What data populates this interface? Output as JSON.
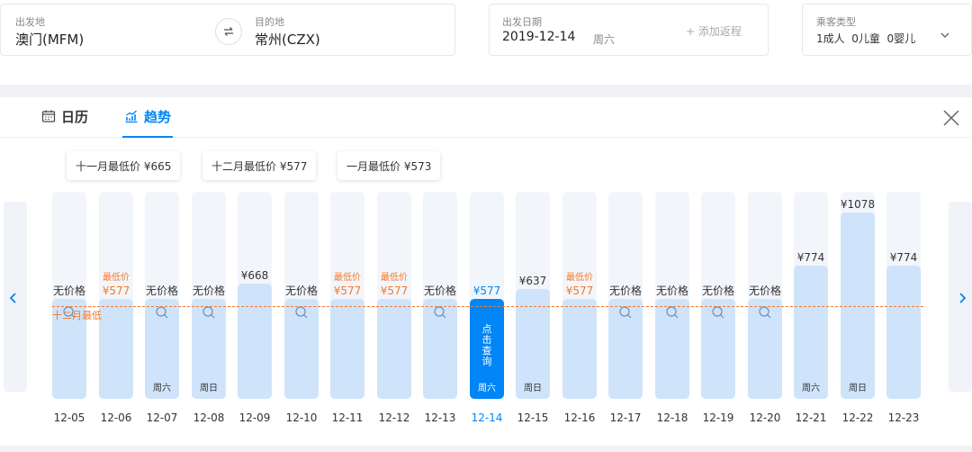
{
  "search": {
    "from_label": "出发地",
    "from_value": "澳门(MFM)",
    "to_label": "目的地",
    "to_value": "常州(CZX)",
    "date_label": "出发日期",
    "date_value": "2019-12-14",
    "weekday_value": "周六",
    "add_return": "+ 添加返程",
    "pax_label": "乘客类型",
    "pax_value": "1成人  0儿童  0婴儿"
  },
  "tabs": {
    "calendar": "日历",
    "trend": "趋势",
    "active": "trend"
  },
  "monthly_low": [
    {
      "label": "十一月最低价 ¥665"
    },
    {
      "label": "十二月最低价 ¥577"
    },
    {
      "label": "一月最低价 ¥573"
    }
  ],
  "lowest_line_label": "十二月最低",
  "click_label": "点击查询",
  "colors": {
    "accent": "#0086f6",
    "lowest": "#f5782b",
    "bar": "#cfe4fb",
    "track": "#f2f6fb"
  },
  "chart_data": {
    "type": "bar",
    "title": "",
    "categories": [
      "12-05",
      "12-06",
      "12-07",
      "12-08",
      "12-09",
      "12-10",
      "12-11",
      "12-12",
      "12-13",
      "12-14",
      "12-15",
      "12-16",
      "12-17",
      "12-18",
      "12-19",
      "12-20",
      "12-21",
      "12-22",
      "12-23"
    ],
    "values": [
      null,
      577,
      null,
      null,
      668,
      null,
      577,
      577,
      null,
      577,
      637,
      577,
      null,
      null,
      null,
      null,
      774,
      1078,
      774
    ],
    "price_labels": [
      "无价格",
      "¥577",
      "无价格",
      "无价格",
      "¥668",
      "无价格",
      "¥577",
      "¥577",
      "无价格",
      "¥577",
      "¥637",
      "¥577",
      "无价格",
      "无价格",
      "无价格",
      "无价格",
      "¥774",
      "¥1078",
      "¥774"
    ],
    "lowest_tag": "最低价",
    "lowest_flags": [
      false,
      true,
      false,
      false,
      false,
      false,
      true,
      true,
      false,
      false,
      false,
      true,
      false,
      false,
      false,
      false,
      false,
      false,
      false
    ],
    "weekday_labels": [
      "",
      "",
      "周六",
      "周日",
      "",
      "",
      "",
      "",
      "",
      "周六",
      "周日",
      "",
      "",
      "",
      "",
      "",
      "周六",
      "周日",
      ""
    ],
    "no_price_fill": 577,
    "selected": "12-14",
    "reference_line": {
      "value": 577,
      "label": "十二月最低"
    }
  }
}
